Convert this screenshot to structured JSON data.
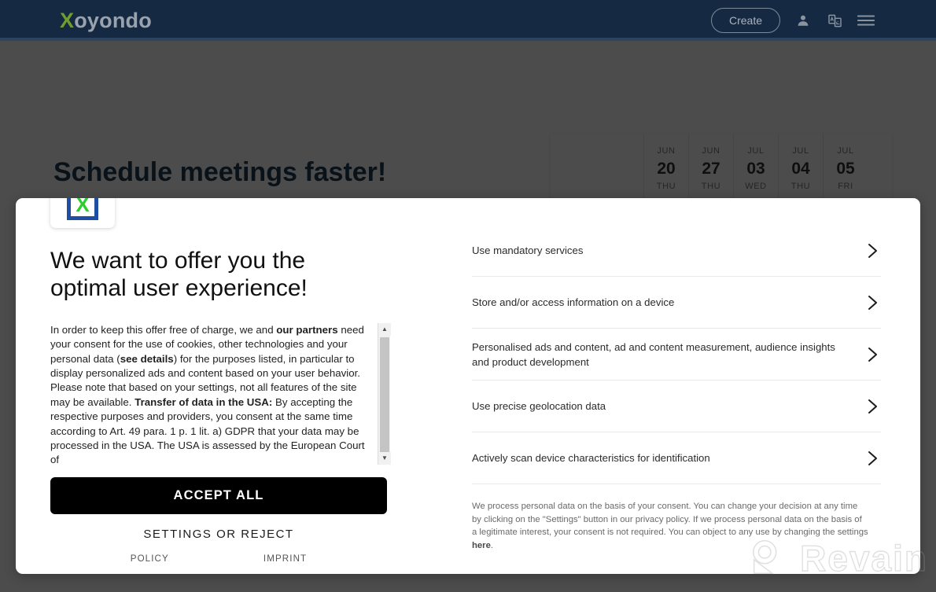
{
  "site": {
    "logo_text": "Xoyondo",
    "logo_accent_letter": "X",
    "logo_rest": "oyondo",
    "create_label": "Create",
    "hero_heading": "Schedule meetings faster!",
    "header_bg": "#152a42",
    "accent_green": "#6f9e2f",
    "icons": {
      "account": "user-icon",
      "language": "language-icon",
      "menu": "hamburger-menu-icon"
    }
  },
  "calendar": {
    "columns": [
      {
        "month": "JUN",
        "day": "20",
        "weekday": "THU"
      },
      {
        "month": "JUN",
        "day": "27",
        "weekday": "THU"
      },
      {
        "month": "JUL",
        "day": "03",
        "weekday": "WED"
      },
      {
        "month": "JUL",
        "day": "04",
        "weekday": "THU"
      },
      {
        "month": "JUL",
        "day": "05",
        "weekday": "FRI"
      }
    ]
  },
  "consent": {
    "brand_icon": "xoyondo-x-logo-icon",
    "headline": "We want to offer you the optimal user experience!",
    "body_part1": "In order to keep this offer free of charge, we and ",
    "body_bold1": "our partners",
    "body_part2": " need your consent for the use of cookies, other technologies and your personal data (",
    "body_bold2": "see details",
    "body_part3": ") for the purposes listed, in particular to display personalized ads and content based on your user behavior. Please note that based on your settings, not all features of the site may be available. ",
    "body_bold3": "Transfer of data in the USA:",
    "body_part4": " By accepting the respective purposes and providers, you consent at the same time according to Art. 49 para. 1 p. 1 lit. a) GDPR that your data may be processed in the USA. The USA is assessed by the European Court of",
    "accept_all_label": "ACCEPT ALL",
    "settings_or_reject_label": "SETTINGS OR REJECT",
    "policy_label": "POLICY",
    "imprint_label": "IMPRINT",
    "purposes": [
      "Use mandatory services",
      "Store and/or access information on a device",
      "Personalised ads and content, ad and content measurement, audience insights and product development",
      "Use precise geolocation data",
      "Actively scan device characteristics for identification"
    ],
    "footer_part1": "We process personal data on the basis of your consent. You can change your decision at any time by clicking on the \"Settings\" button in our privacy policy. If we process personal data on the basis of a legitimate interest, your consent is not required. You can object to any use by changing the settings ",
    "footer_link": "here",
    "footer_part2": ".",
    "chevron_icon": "chevron-right-icon",
    "accept_bg": "#000000"
  },
  "watermark": {
    "text": "Revain",
    "icon": "revain-logo-icon"
  }
}
